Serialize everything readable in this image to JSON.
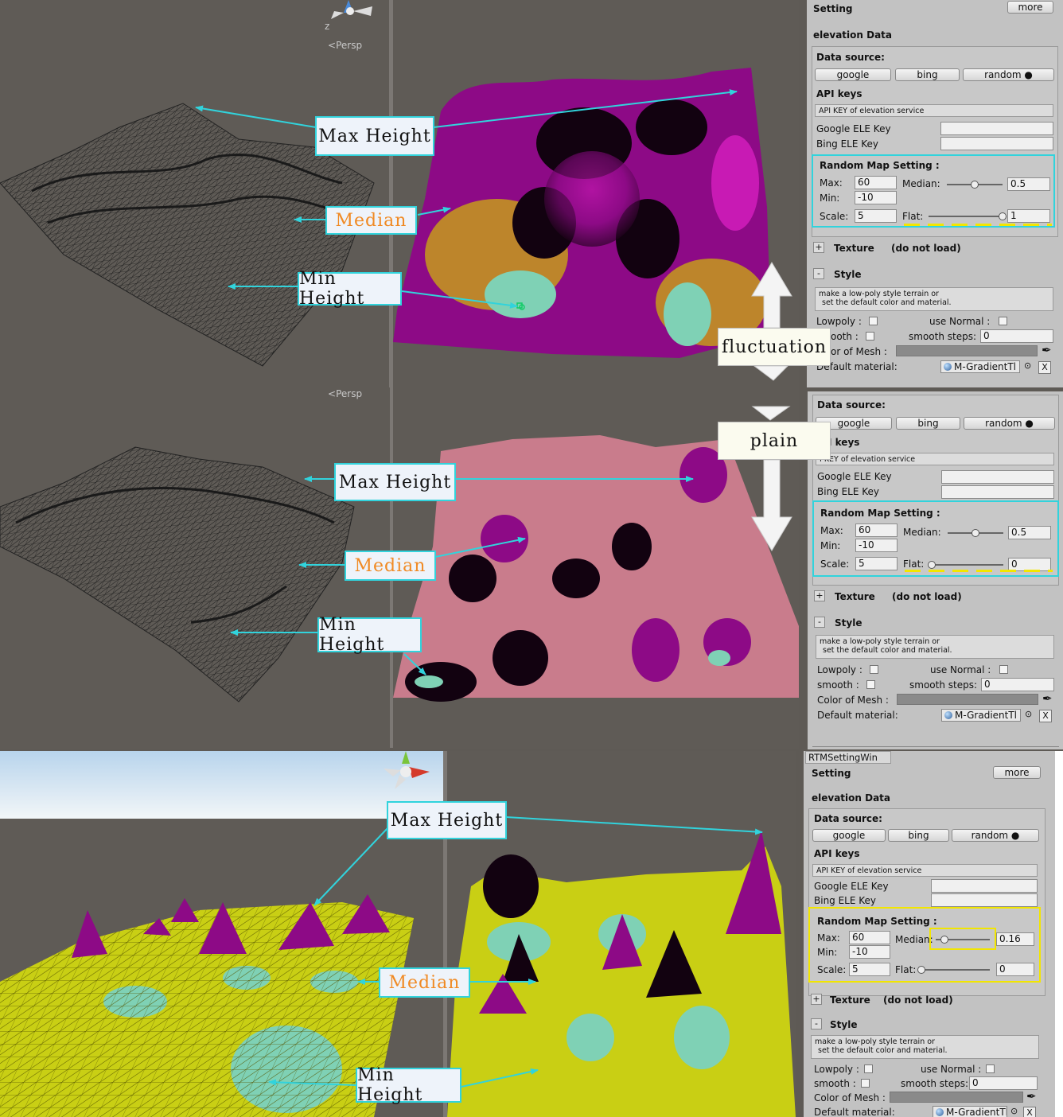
{
  "views": {
    "persp_label": "Persp",
    "axis_label": "z"
  },
  "callouts": {
    "max_height": "Max Height",
    "median": "Median",
    "min_height": "Min Height",
    "fluctuation": "fluctuation",
    "plain": "plain"
  },
  "panel": {
    "setting": "Setting",
    "more": "more",
    "elevation_data": "elevation Data",
    "data_source": "Data source:",
    "google": "google",
    "bing": "bing",
    "random": "random ●",
    "api_keys": "API keys",
    "api_hint": "API KEY of elevation service",
    "google_key": "Google ELE Key",
    "bing_key": "Bing ELE Key",
    "random_map_setting": "Random Map Setting :",
    "max_label": "Max:",
    "min_label": "Min:",
    "median_label": "Median:",
    "scale_label": "Scale:",
    "flat_label": "Flat:",
    "max_value": "60",
    "min_value": "-10",
    "scale_value": "5",
    "texture": "Texture",
    "do_not_load": "(do not load)",
    "style": "Style",
    "style_help_1": "make a low-poly style terrain or",
    "style_help_2": "set the default color and material.",
    "lowpoly": "Lowpoly :",
    "use_normal": "use Normal :",
    "smooth": "smooth :",
    "smooth_steps": "smooth steps:",
    "smooth_steps_value": "0",
    "color_of_mesh": "Color of Mesh :",
    "default_material": "Default material:",
    "material_value": "M-GradientTl",
    "plus": "+",
    "minus": "-",
    "x": "X",
    "window_title": "RTMSettingWin"
  },
  "panel_top": {
    "median_value": "0.5",
    "flat_value": "1",
    "api_keys_clipped": "API keys",
    "smooth_clipped": "ooth :",
    "color_clipped": "or of Mesh :",
    "default_clipped": "Default material:"
  },
  "panel_mid": {
    "median_value": "0.5",
    "flat_value": "0",
    "api_keys_clipped": "I keys",
    "api_hint_clipped": "I KEY of elevation service"
  },
  "panel_bottom": {
    "median_value": "0.16",
    "flat_value": "0"
  },
  "slider_levels": {
    "top_median": 0.5,
    "top_flat": 1,
    "mid_median": 0.5,
    "mid_flat": 0,
    "bottom_median": 0.16,
    "bottom_flat": 0
  },
  "colors": {
    "callout_border": "#31d3dc",
    "median_text": "#f08a24",
    "highlight_cyan": "#31d3dc",
    "highlight_yellow": "#f2e600",
    "terrain_magenta": "#a0108c",
    "terrain_yellow": "#c9cf14",
    "terrain_cyan": "#7fd1b5",
    "terrain_pink": "#c97c8c"
  }
}
